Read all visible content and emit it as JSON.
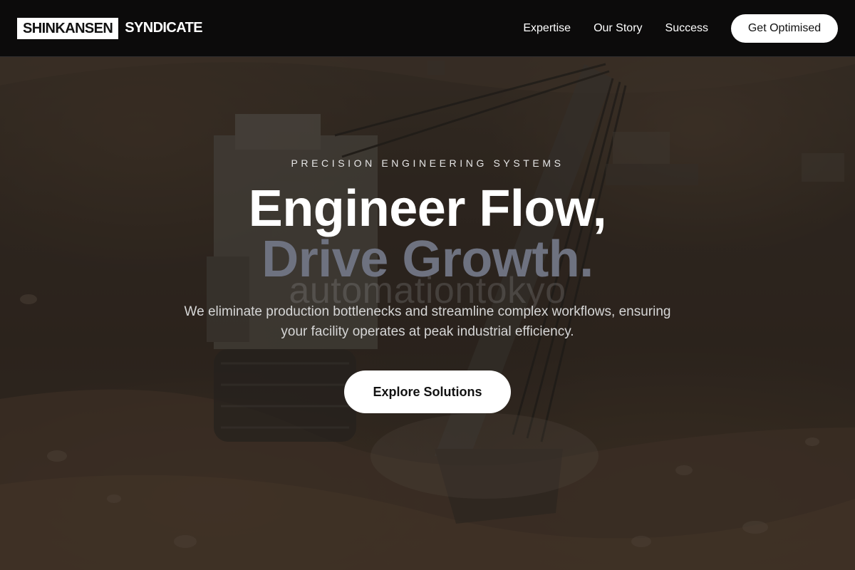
{
  "brand": {
    "box_text": "SHINKANSEN",
    "text": "SYNDICATE"
  },
  "nav": {
    "links": [
      {
        "label": "Expertise"
      },
      {
        "label": "Our Story"
      },
      {
        "label": "Success"
      }
    ],
    "cta_label": "Get Optimised"
  },
  "hero": {
    "eyebrow": "PRECISION ENGINEERING SYSTEMS",
    "headline_line1": "Engineer Flow,",
    "headline_line2": "Drive Growth.",
    "watermark": "automationtokyo",
    "subtext": "We eliminate production bottlenecks and streamline complex workflows, ensuring your facility operates at peak industrial efficiency.",
    "cta_label": "Explore Solutions"
  },
  "colors": {
    "accent_white": "#ffffff",
    "headline_muted": "#6e7280",
    "nav_bg": "#0a0a0a"
  }
}
